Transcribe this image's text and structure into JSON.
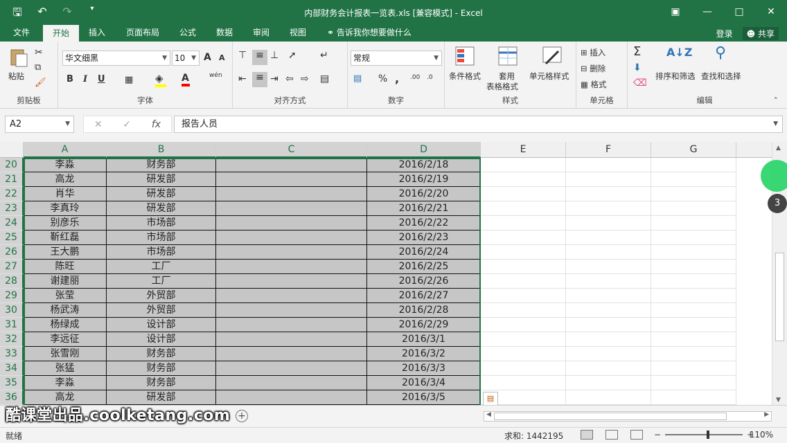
{
  "window": {
    "title": "内部财务会计报表一览表.xls  [兼容模式] - Excel",
    "qat": {
      "save_icon": "save-icon",
      "undo_icon": "undo-icon",
      "redo_icon": "redo-icon",
      "customize_icon": "customize-qat-icon"
    },
    "controls": {
      "ribbon_display": "ribbon-display-icon",
      "minimize": "minimize-icon",
      "maximize": "maximize-icon",
      "close": "close-icon"
    }
  },
  "menu": {
    "tabs": [
      "文件",
      "开始",
      "插入",
      "页面布局",
      "公式",
      "数据",
      "审阅",
      "视图"
    ],
    "active": "开始",
    "tell_me": "告诉我你想要做什么",
    "login": "登录",
    "share": "共享"
  },
  "ribbon": {
    "clipboard": {
      "paste": "粘贴",
      "label": "剪贴板"
    },
    "font": {
      "family": "华文细黑",
      "size": "10",
      "bold": "B",
      "italic": "I",
      "underline": "U",
      "grow": "A",
      "shrink": "A",
      "phonetic": "wén",
      "label": "字体"
    },
    "alignment": {
      "label": "对齐方式"
    },
    "number": {
      "format": "常规",
      "percent": "%",
      "comma": ",",
      "label": "数字"
    },
    "styles": {
      "conditional": "条件格式",
      "table_line1": "套用",
      "table_line2": "表格格式",
      "cell_styles": "单元格样式",
      "label": "样式"
    },
    "cells": {
      "insert": "插入",
      "delete": "删除",
      "format": "格式",
      "label": "单元格"
    },
    "editing": {
      "sort_filter": "排序和筛选",
      "find_select": "查找和选择",
      "label": "编辑"
    }
  },
  "formula_bar": {
    "name_box": "A2",
    "cancel": "✕",
    "enter": "✓",
    "fx": "fx",
    "content": "报告人员"
  },
  "columns": [
    "A",
    "B",
    "C",
    "D",
    "E",
    "F",
    "G"
  ],
  "rows": [
    {
      "n": "20",
      "a": "李淼",
      "b": "财务部",
      "c": "",
      "d": "2016/2/18"
    },
    {
      "n": "21",
      "a": "高龙",
      "b": "研发部",
      "c": "",
      "d": "2016/2/19"
    },
    {
      "n": "22",
      "a": "肖华",
      "b": "研发部",
      "c": "",
      "d": "2016/2/20"
    },
    {
      "n": "23",
      "a": "李真玲",
      "b": "研发部",
      "c": "",
      "d": "2016/2/21"
    },
    {
      "n": "24",
      "a": "别彦乐",
      "b": "市场部",
      "c": "",
      "d": "2016/2/22"
    },
    {
      "n": "25",
      "a": "靳红磊",
      "b": "市场部",
      "c": "",
      "d": "2016/2/23"
    },
    {
      "n": "26",
      "a": "王大鹏",
      "b": "市场部",
      "c": "",
      "d": "2016/2/24"
    },
    {
      "n": "27",
      "a": "陈旺",
      "b": "工厂",
      "c": "",
      "d": "2016/2/25"
    },
    {
      "n": "28",
      "a": "谢建丽",
      "b": "工厂",
      "c": "",
      "d": "2016/2/26"
    },
    {
      "n": "29",
      "a": "张莹",
      "b": "外贸部",
      "c": "",
      "d": "2016/2/27"
    },
    {
      "n": "30",
      "a": "杨武涛",
      "b": "外贸部",
      "c": "",
      "d": "2016/2/28"
    },
    {
      "n": "31",
      "a": "杨绿成",
      "b": "设计部",
      "c": "",
      "d": "2016/2/29"
    },
    {
      "n": "32",
      "a": "李远征",
      "b": "设计部",
      "c": "",
      "d": "2016/3/1"
    },
    {
      "n": "33",
      "a": "张雪刚",
      "b": "财务部",
      "c": "",
      "d": "2016/3/2"
    },
    {
      "n": "34",
      "a": "张猛",
      "b": "财务部",
      "c": "",
      "d": "2016/3/3"
    },
    {
      "n": "35",
      "a": "李淼",
      "b": "财务部",
      "c": "",
      "d": "2016/3/4"
    },
    {
      "n": "36",
      "a": "高龙",
      "b": "研发部",
      "c": "",
      "d": "2016/3/5"
    }
  ],
  "overlay": {
    "badge": "3"
  },
  "sheetbar": {
    "watermark": "酷课堂出品.coolketang.com",
    "add_sheet": "+"
  },
  "status": {
    "ready": "就绪",
    "sum": "求和: 1442195",
    "zoom": "110%",
    "zoom_out": "−",
    "zoom_in": "+"
  },
  "colors": {
    "accent": "#217346",
    "selection": "#c6c6c6"
  }
}
